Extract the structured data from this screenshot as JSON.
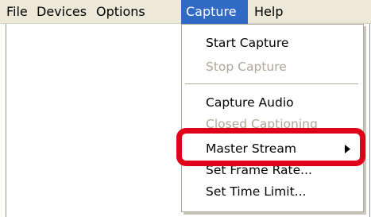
{
  "menubar": {
    "items": [
      {
        "label": "File"
      },
      {
        "label": "Devices"
      },
      {
        "label": "Options"
      },
      {
        "label": "Capture",
        "active": true
      },
      {
        "label": "Help"
      }
    ]
  },
  "capture_menu": {
    "items": [
      {
        "label": "Start Capture",
        "enabled": true
      },
      {
        "label": "Stop Capture",
        "enabled": false
      },
      {
        "label": "Capture Audio",
        "enabled": true
      },
      {
        "label": "Closed Captioning",
        "enabled": false
      },
      {
        "label": "Master Stream",
        "enabled": true,
        "submenu": true
      },
      {
        "label": "Set Frame Rate...",
        "enabled": true
      },
      {
        "label": "Set Time Limit...",
        "enabled": true
      }
    ]
  },
  "annotation": {
    "highlight_color": "#e0001a"
  },
  "colors": {
    "menubar_bg": "#ece9d8",
    "active_menu_bg": "#316ac5",
    "disabled_text": "#aca899"
  }
}
